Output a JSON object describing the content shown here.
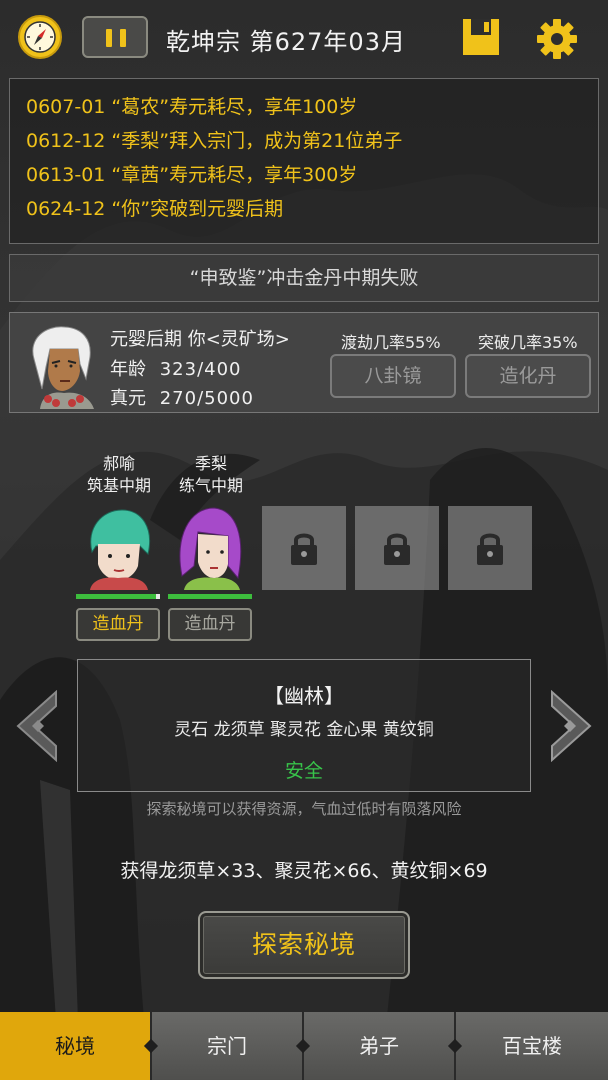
{
  "colors": {
    "accent": "#f0c21a",
    "safe": "#38c44a",
    "tab_active": "#e0a70c",
    "hp": "#3dbd3d"
  },
  "header": {
    "title": "乾坤宗 第627年03月",
    "icons": [
      "compass-icon",
      "pause-icon",
      "save-icon",
      "gear-icon"
    ]
  },
  "log": [
    "0607-01 “葛农”寿元耗尽，享年100岁",
    "0612-12 “季梨”拜入宗门，成为第21位弟子",
    "0613-01 “章茜”寿元耗尽，享年300岁",
    "0624-12 “你”突破到元婴后期"
  ],
  "notice": "“申致鉴”冲击金丹中期失败",
  "player": {
    "realm_line": "元婴后期 你<灵矿场>",
    "age_label": "年龄",
    "age_value": "323/400",
    "energy_label": "真元",
    "energy_value": "270/5000",
    "tribulation_rate": "渡劫几率55%",
    "breakthrough_rate": "突破几率35%",
    "bagua_button": "八卦镜",
    "pill_button": "造化丹"
  },
  "disciples": [
    {
      "name": "郝喻",
      "realm": "筑基中期",
      "button": "造血丹",
      "hp": 0.95
    },
    {
      "name": "季梨",
      "realm": "练气中期",
      "button": "造血丹",
      "hp": 1.0
    }
  ],
  "locked_slots": 3,
  "realm": {
    "name": "【幽林】",
    "resources": "灵石 龙须草 聚灵花 金心果 黄纹铜",
    "status": "安全"
  },
  "hint": "探索秘境可以获得资源，气血过低时有陨落风险",
  "gain": "获得龙须草×33、聚灵花×66、黄纹铜×69",
  "explore_button": "探索秘境",
  "nav": [
    "秘境",
    "宗门",
    "弟子",
    "百宝楼"
  ]
}
